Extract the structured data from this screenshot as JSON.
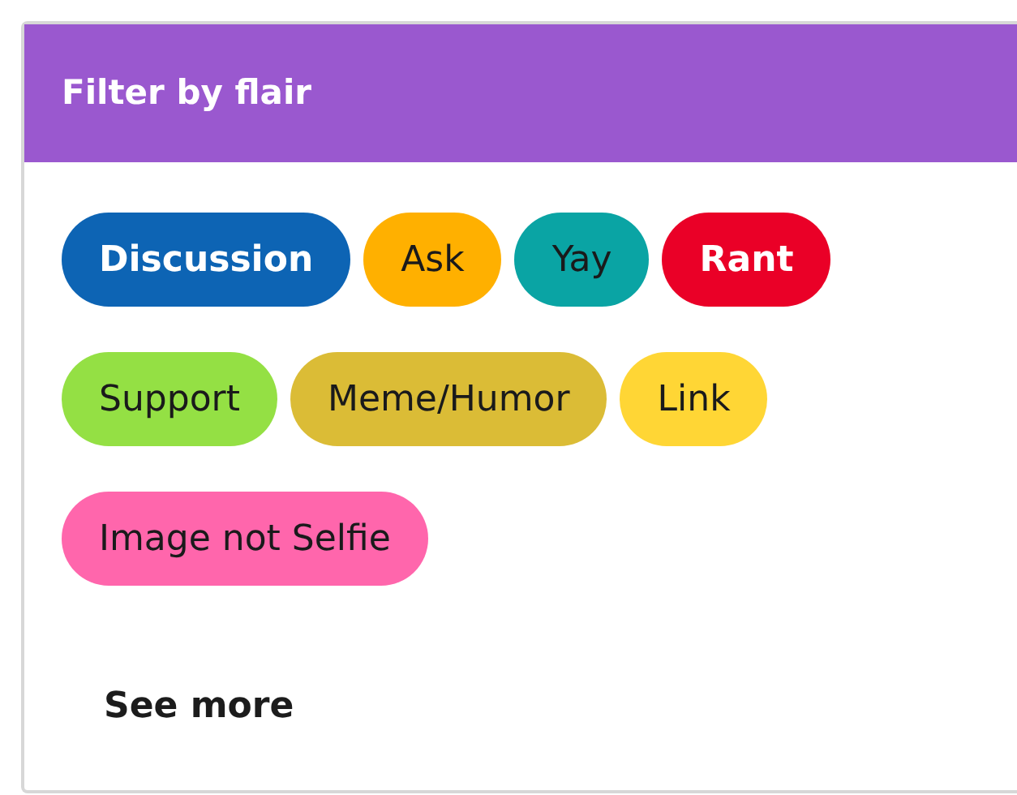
{
  "widget": {
    "title": "Filter by flair",
    "flairs": [
      {
        "label": "Discussion",
        "color": "#0d64b4"
      },
      {
        "label": "Ask",
        "color": "#ffb000"
      },
      {
        "label": "Yay",
        "color": "#0aa4a4"
      },
      {
        "label": "Rant",
        "color": "#ea0027"
      },
      {
        "label": "Support",
        "color": "#94e044"
      },
      {
        "label": "Meme/Humor",
        "color": "#dbbc36"
      },
      {
        "label": "Link",
        "color": "#ffd635"
      },
      {
        "label": "Image not Selfie",
        "color": "#ff66ac"
      }
    ],
    "see_more": "See more"
  }
}
